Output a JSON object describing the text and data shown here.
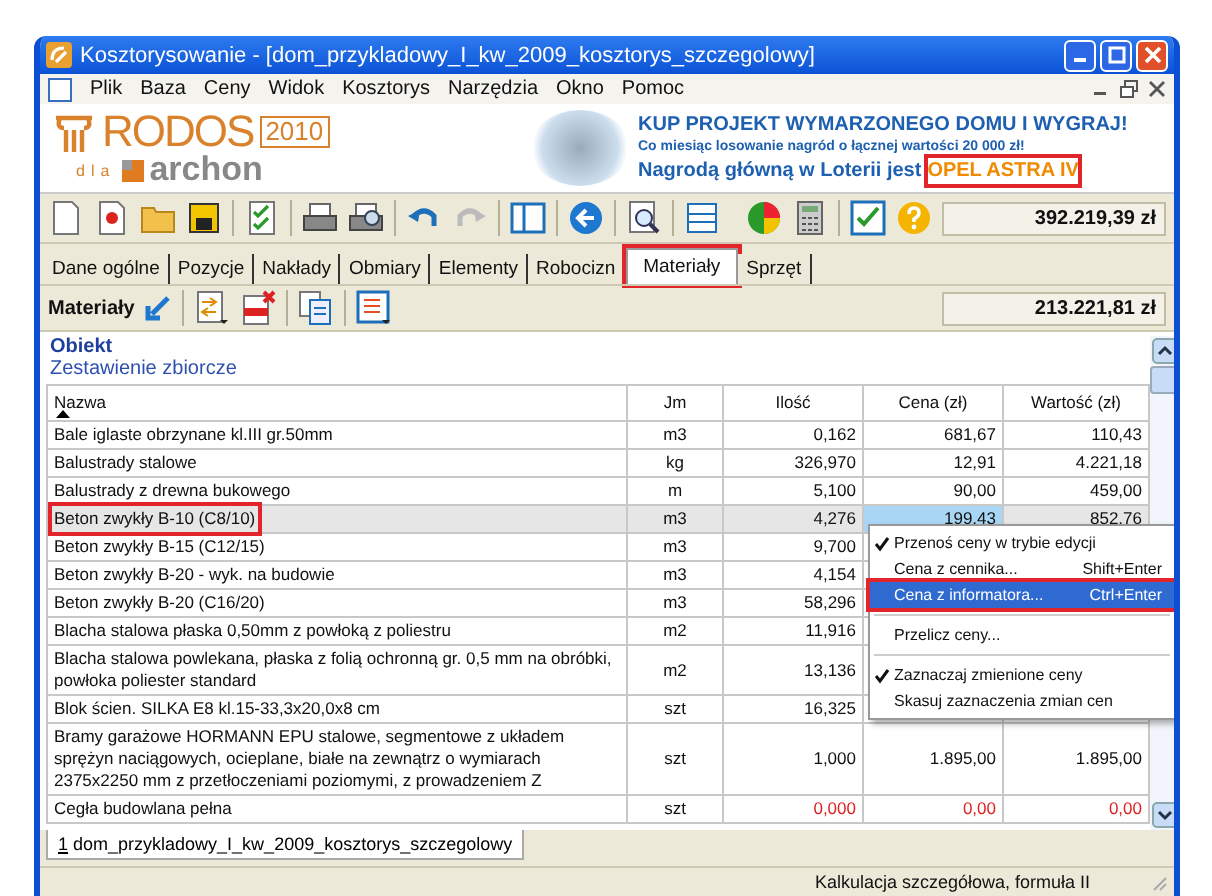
{
  "window": {
    "title": "Kosztorysowanie - [dom_przykladowy_I_kw_2009_kosztorys_szczegolowy]"
  },
  "menu": [
    "Plik",
    "Baza",
    "Ceny",
    "Widok",
    "Kosztorys",
    "Narzędzia",
    "Okno",
    "Pomoc"
  ],
  "banner": {
    "logo_name": "RODOS",
    "logo_year": "2010",
    "logo_for": "dla",
    "logo_brand": "archon",
    "headline": "KUP PROJEKT WYMARZONEGO DOMU I WYGRAJ!",
    "subline": "Co miesiąc losowanie nagród o łącznej wartości **20 000 zł**!",
    "prize": "Nagrodą główną w Loterii jest",
    "prize_highlight": "OPEL ASTRA IV"
  },
  "toolbar": {
    "total": "392.219,39 zł"
  },
  "tabs": [
    {
      "label": "Dane ogólne",
      "selected": false,
      "highlighted": false
    },
    {
      "label": "Pozycje",
      "selected": false,
      "highlighted": false
    },
    {
      "label": "Nakłady",
      "selected": false,
      "highlighted": false
    },
    {
      "label": "Obmiary",
      "selected": false,
      "highlighted": false
    },
    {
      "label": "Elementy",
      "selected": false,
      "highlighted": false
    },
    {
      "label": "Robocizn",
      "selected": false,
      "highlighted": false
    },
    {
      "label": "Materiały",
      "selected": true,
      "highlighted": true
    },
    {
      "label": "Sprzęt",
      "selected": false,
      "highlighted": false
    }
  ],
  "subtoolbar": {
    "title": "Materiały",
    "total": "213.221,81 zł"
  },
  "object": {
    "title": "Obiekt",
    "subtitle": "Zestawienie zbiorcze"
  },
  "table": {
    "columns": [
      "Nazwa",
      "Jm",
      "Ilość",
      "Cena (zł)",
      "Wartość (zł)"
    ],
    "rows": [
      {
        "name": "Bale iglaste obrzynane kl.III gr.50mm",
        "jm": "m3",
        "qty": "0,162",
        "price": "681,67",
        "value": "110,43",
        "selected": false,
        "highlighted": false,
        "editing": false,
        "zero": false
      },
      {
        "name": "Balustrady stalowe",
        "jm": "kg",
        "qty": "326,970",
        "price": "12,91",
        "value": "4.221,18",
        "selected": false,
        "highlighted": false,
        "editing": false,
        "zero": false
      },
      {
        "name": "Balustrady z drewna bukowego",
        "jm": "m",
        "qty": "5,100",
        "price": "90,00",
        "value": "459,00",
        "selected": false,
        "highlighted": false,
        "editing": false,
        "zero": false
      },
      {
        "name": "Beton zwykły B-10 (C8/10)",
        "jm": "m3",
        "qty": "4,276",
        "price": "199,43",
        "value": "852,76",
        "selected": true,
        "highlighted": true,
        "editing": true,
        "zero": false
      },
      {
        "name": "Beton zwykły B-15 (C12/15)",
        "jm": "m3",
        "qty": "9,700",
        "selected": false,
        "highlighted": false,
        "zero": false
      },
      {
        "name": "Beton zwykły B-20 - wyk. na budowie",
        "jm": "m3",
        "qty": "4,154",
        "selected": false,
        "highlighted": false,
        "zero": false
      },
      {
        "name": "Beton zwykły B-20 (C16/20)",
        "jm": "m3",
        "qty": "58,296",
        "selected": false,
        "highlighted": false,
        "zero": false
      },
      {
        "name": "Blacha stalowa płaska 0,50mm z powłoką z poliestru",
        "jm": "m2",
        "qty": "11,916",
        "selected": false,
        "highlighted": false,
        "zero": false
      },
      {
        "name": "Blacha stalowa powlekana, płaska z folią ochronną gr. 0,5 mm na obróbki, powłoka poliester standard",
        "jm": "m2",
        "qty": "13,136",
        "selected": false,
        "highlighted": false,
        "zero": false
      },
      {
        "name": "Blok ścien. SILKA E8 kl.15-33,3x20,0x8 cm",
        "jm": "szt",
        "qty": "16,325",
        "selected": false,
        "highlighted": false,
        "zero": false
      },
      {
        "name": "Bramy garażowe HORMANN EPU stalowe, segmentowe z układem sprężyn naciągowych, ocieplane, białe na zewnątrz o wymiarach 2375x2250 mm z przetłoczeniami poziomymi, z prowadzeniem Z",
        "jm": "szt",
        "qty": "1,000",
        "price": "1.895,00",
        "value": "1.895,00",
        "selected": false,
        "highlighted": false,
        "editing": false,
        "zero": false
      },
      {
        "name": "Cegła budowlana pełna",
        "jm": "szt",
        "qty": "0,000",
        "price": "0,00",
        "value": "0,00",
        "selected": false,
        "highlighted": false,
        "editing": false,
        "zero": true
      }
    ]
  },
  "context_menu": [
    {
      "kind": "item",
      "label": "Przenoś ceny w trybie edycji",
      "checked": true,
      "selected": false,
      "highlighted": false
    },
    {
      "kind": "item",
      "label": "Cena z cennika...",
      "shortcut": "Shift+Enter",
      "checked": false,
      "selected": false,
      "highlighted": false
    },
    {
      "kind": "item",
      "label": "Cena z informatora...",
      "shortcut": "Ctrl+Enter",
      "checked": false,
      "selected": true,
      "highlighted": true
    },
    {
      "kind": "separator"
    },
    {
      "kind": "item",
      "label": "Przelicz ceny...",
      "checked": false,
      "selected": false,
      "highlighted": false
    },
    {
      "kind": "separator"
    },
    {
      "kind": "item",
      "label": "Zaznaczaj zmienione ceny",
      "checked": true,
      "selected": false,
      "highlighted": false
    },
    {
      "kind": "item",
      "label": "Skasuj zaznaczenia zmian cen",
      "checked": false,
      "selected": false,
      "highlighted": false
    }
  ],
  "document_tab": {
    "index": "1",
    "label": "dom_przykladowy_I_kw_2009_kosztorys_szczegolowy"
  },
  "status_bar": "Kalkulacja szczegółowa, formuła II"
}
